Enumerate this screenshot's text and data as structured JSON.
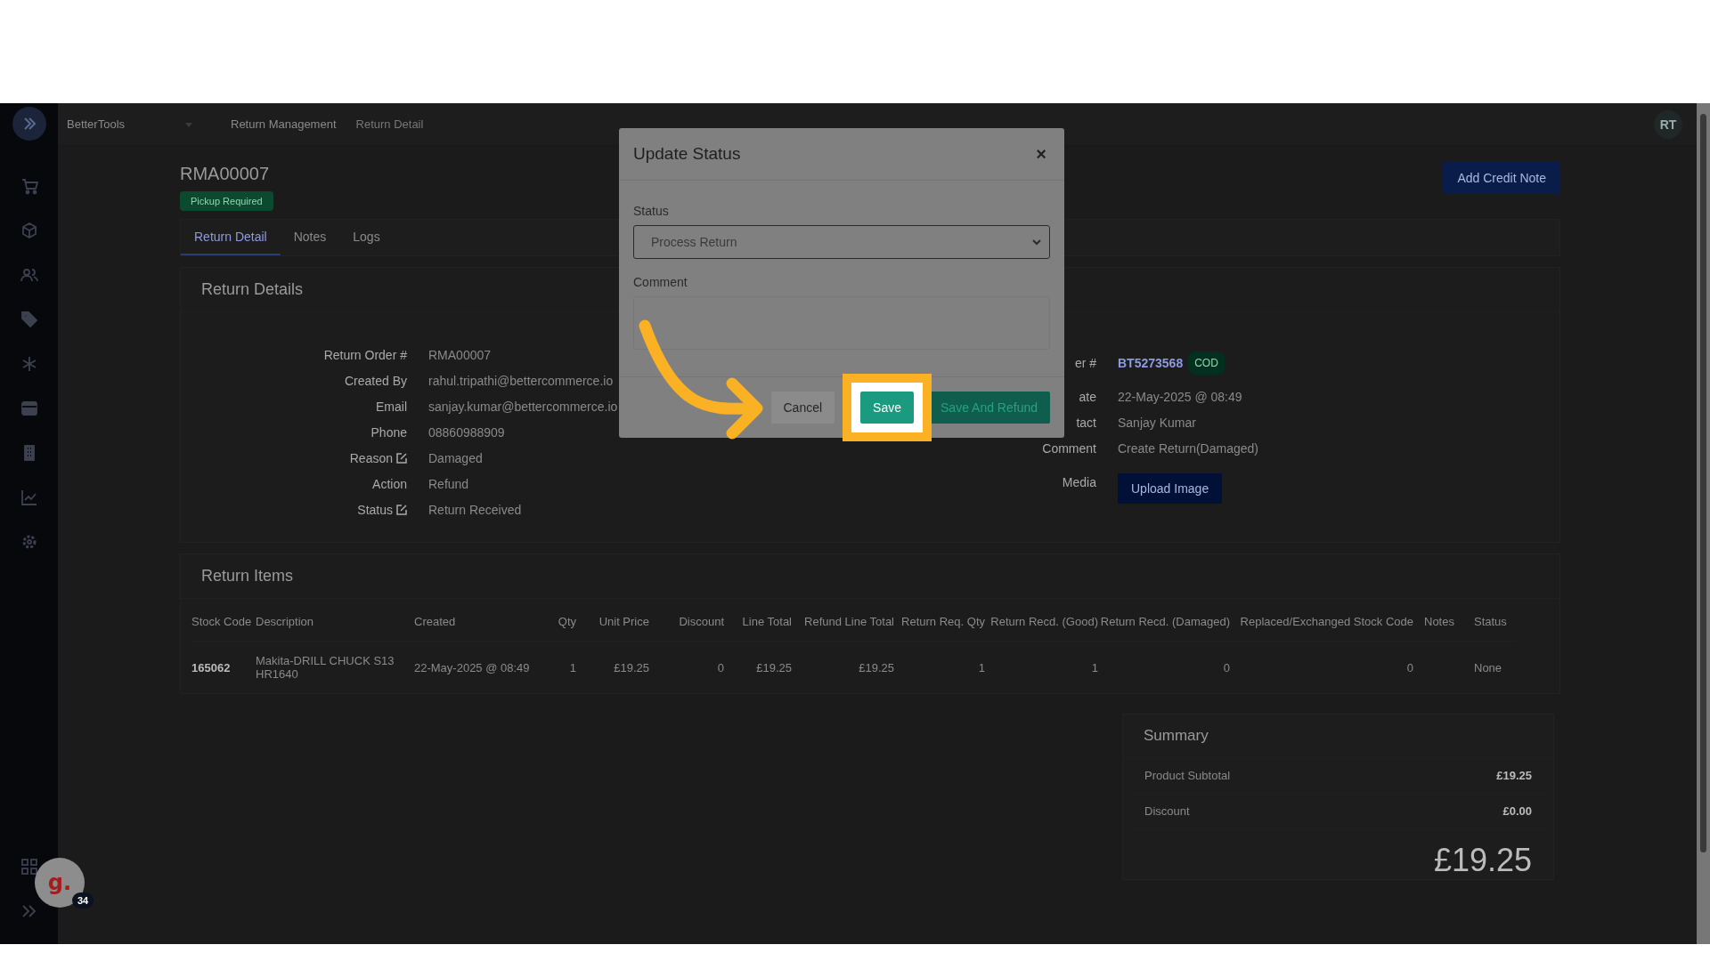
{
  "topbar": {
    "store": "BetterTools",
    "breadcrumbs": [
      "Return Management",
      "Return Detail"
    ],
    "user_initials": "RT"
  },
  "page": {
    "title": "RMA00007",
    "status_badge": "Pickup Required",
    "add_credit_note": "Add Credit Note"
  },
  "tabs": [
    {
      "label": "Return Detail",
      "selected": true
    },
    {
      "label": "Notes",
      "selected": false
    },
    {
      "label": "Logs",
      "selected": false
    }
  ],
  "return_details": {
    "title": "Return Details",
    "left": [
      {
        "label": "Return Order #",
        "value": "RMA00007",
        "editable": false
      },
      {
        "label": "Created By",
        "value": "rahul.tripathi@bettercommerce.io",
        "editable": false
      },
      {
        "label": "Email",
        "value": "sanjay.kumar@bettercommerce.io",
        "editable": false
      },
      {
        "label": "Phone",
        "value": "08860988909",
        "editable": false
      },
      {
        "label": "Reason",
        "value": "Damaged",
        "editable": true
      },
      {
        "label": "Action",
        "value": "Refund",
        "editable": false
      },
      {
        "label": "Status",
        "value": "Return Received",
        "editable": true
      }
    ],
    "right": [
      {
        "kind": "link",
        "label": "er #",
        "value": "BT5273568",
        "badge": "COD"
      },
      {
        "kind": "text",
        "label": "ate",
        "value": "22-May-2025 @ 08:49"
      },
      {
        "kind": "text",
        "label": "tact",
        "value": "Sanjay Kumar"
      },
      {
        "kind": "text",
        "label": "Comment",
        "value": "Create Return(Damaged)"
      },
      {
        "kind": "button",
        "label": "Media",
        "value": "Upload Image"
      }
    ]
  },
  "return_items": {
    "title": "Return Items",
    "columns": [
      "Stock Code",
      "Description",
      "Created",
      "Qty",
      "Unit Price",
      "Discount",
      "Line Total",
      "Refund Line Total",
      "Return Req. Qty",
      "Return Recd. (Good)",
      "Return Recd. (Damaged)",
      "Replaced/Exchanged Stock Code",
      "Notes",
      "Status"
    ],
    "rows": [
      {
        "cells": [
          "165062",
          "Makita-DRILL CHUCK S13 HR1640",
          "22-May-2025 @ 08:49",
          "1",
          "£19.25",
          "0",
          "£19.25",
          "£19.25",
          "1",
          "1",
          "0",
          "0",
          null,
          "None"
        ]
      }
    ]
  },
  "summary": {
    "title": "Summary",
    "rows": [
      {
        "label": "Product Subtotal",
        "value": "£19.25"
      },
      {
        "label": "Discount",
        "value": "£0.00"
      }
    ],
    "total": "£19.25"
  },
  "modal": {
    "title": "Update Status",
    "close": "×",
    "status_label": "Status",
    "status_value": "Process Return",
    "comment_label": "Comment",
    "buttons": [
      {
        "label": "Cancel",
        "kind": "secondary",
        "highlighted": false
      },
      {
        "label": "Save",
        "kind": "primary",
        "highlighted": true
      },
      {
        "label": "Save And Refund",
        "kind": "primary",
        "highlighted": false
      }
    ]
  },
  "widget": {
    "logo": "g.",
    "badge": "34"
  }
}
